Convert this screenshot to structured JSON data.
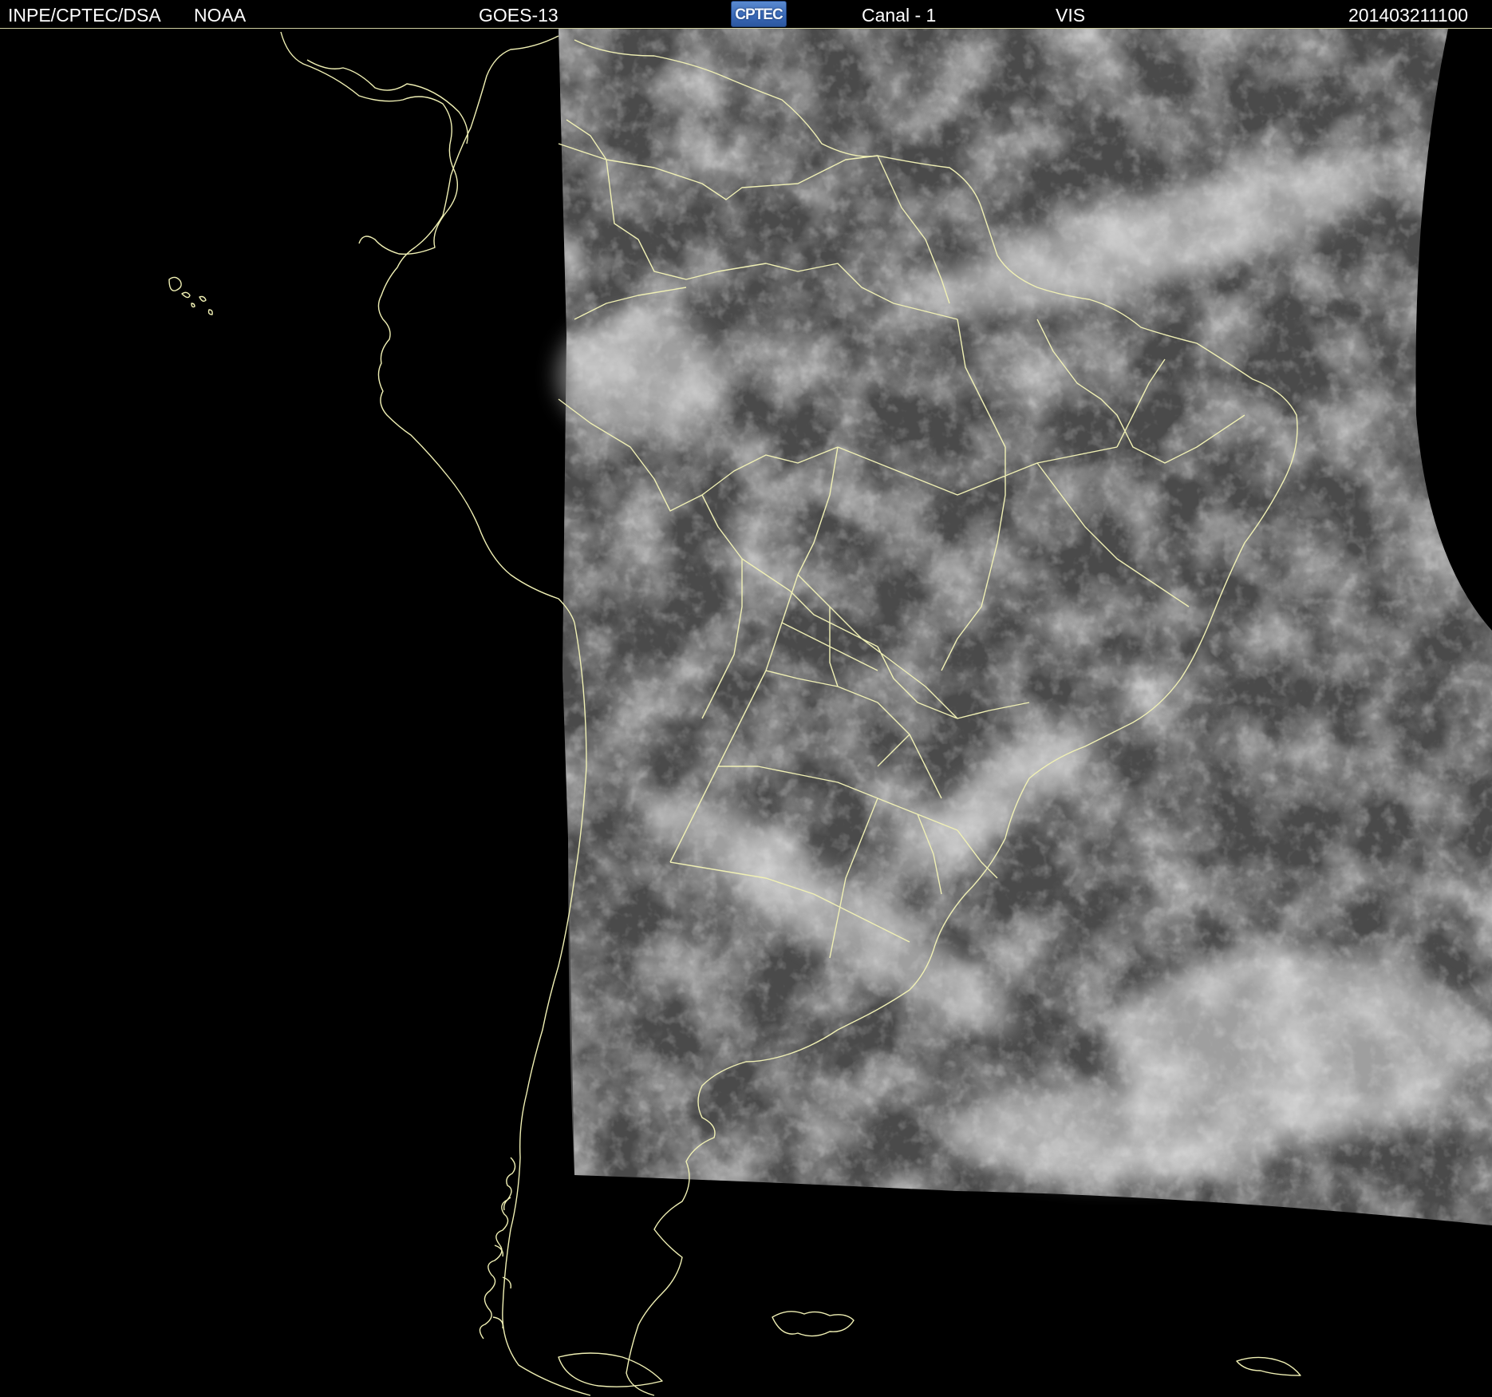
{
  "header": {
    "agency": "INPE/CPTEC/DSA",
    "source": "NOAA",
    "satellite": "GOES-13",
    "logo_text": "CPTEC",
    "channel": "Canal - 1",
    "band": "VIS",
    "datetime": "201403211100"
  },
  "colors": {
    "background": "#000000",
    "header_text": "#ffffff",
    "borders": "#f0f0b4",
    "logo": "#3a6ab8"
  },
  "icons": {
    "logo": "cptec-logo"
  }
}
